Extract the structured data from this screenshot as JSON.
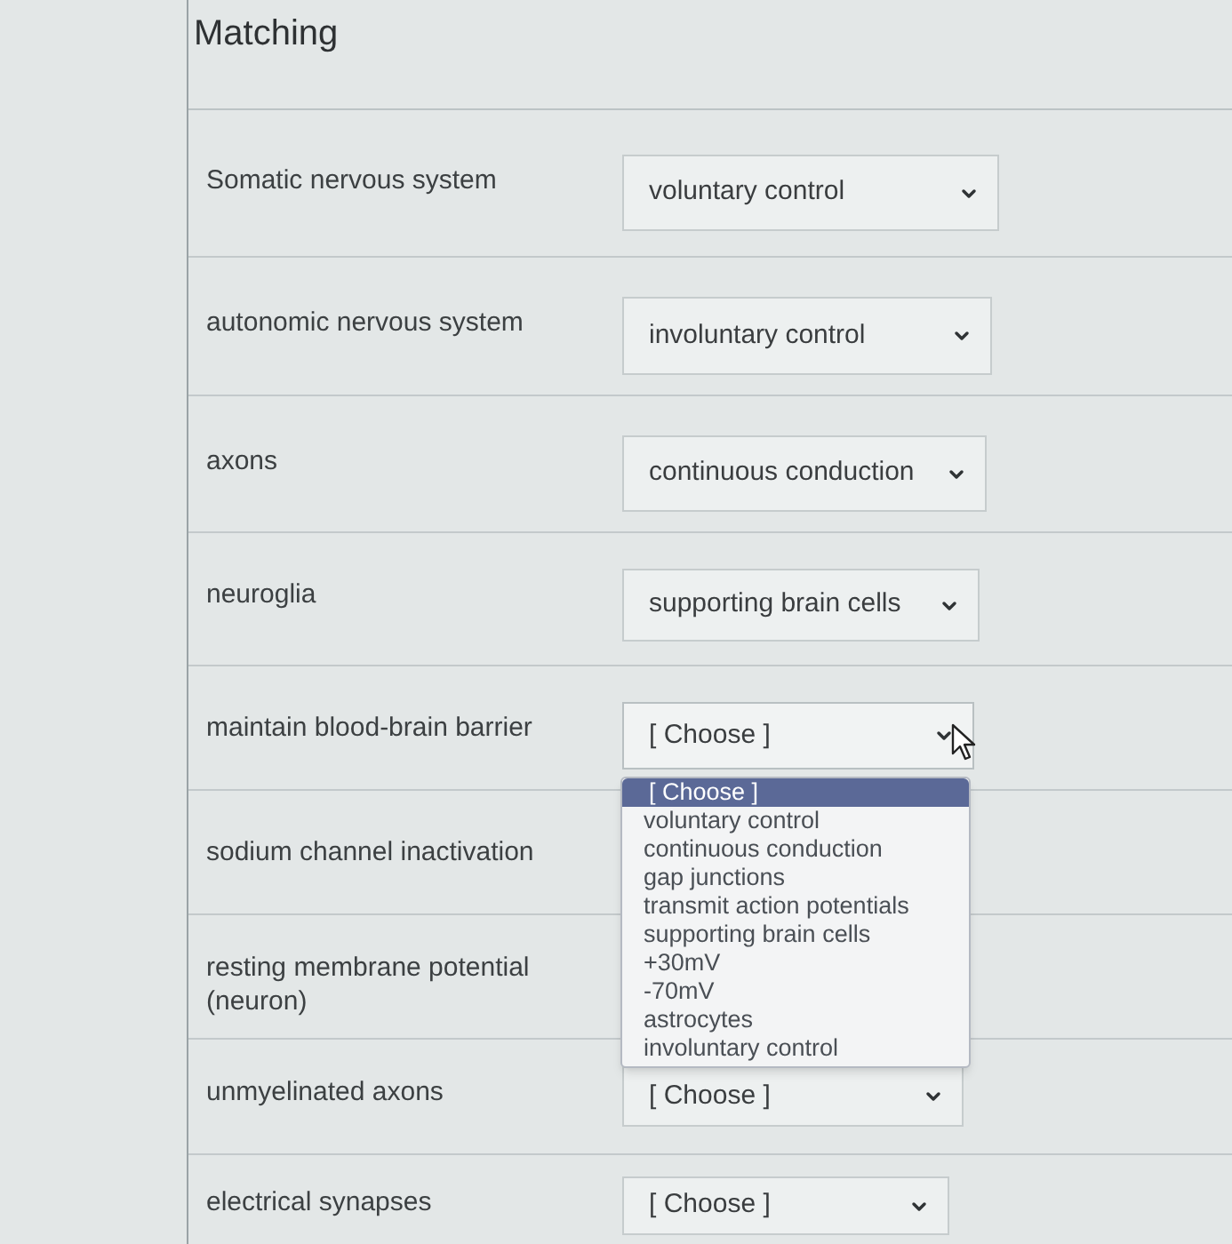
{
  "title": "Matching",
  "rows": [
    {
      "prompt": "Somatic nervous system",
      "answer": {
        "value": "voluntary control",
        "expanded": false
      }
    },
    {
      "prompt": "autonomic nervous system",
      "answer": {
        "value": "involuntary control",
        "expanded": false
      }
    },
    {
      "prompt": "axons",
      "answer": {
        "value": "continuous conduction",
        "expanded": false
      }
    },
    {
      "prompt": "neuroglia",
      "answer": {
        "value": "supporting brain cells",
        "expanded": false
      }
    },
    {
      "prompt": "maintain blood-brain barrier",
      "answer": {
        "value": "[ Choose ]",
        "expanded": true,
        "options": [
          {
            "label": "[ Choose ]",
            "selected": true
          },
          {
            "label": "voluntary control",
            "selected": false
          },
          {
            "label": "continuous conduction",
            "selected": false
          },
          {
            "label": "gap junctions",
            "selected": false
          },
          {
            "label": "transmit action potentials",
            "selected": false
          },
          {
            "label": "supporting brain cells",
            "selected": false
          },
          {
            "label": "+30mV",
            "selected": false
          },
          {
            "label": "-70mV",
            "selected": false
          },
          {
            "label": "astrocytes",
            "selected": false
          },
          {
            "label": "involuntary control",
            "selected": false
          }
        ]
      }
    },
    {
      "prompt": "sodium channel inactivation"
    },
    {
      "prompt": "resting membrane potential (neuron)"
    },
    {
      "prompt": "unmyelinated axons",
      "answer": {
        "value": "[ Choose ]",
        "expanded": false
      }
    },
    {
      "prompt": "electrical synapses",
      "answer": {
        "value": "[ Choose ]",
        "expanded": false
      }
    }
  ]
}
